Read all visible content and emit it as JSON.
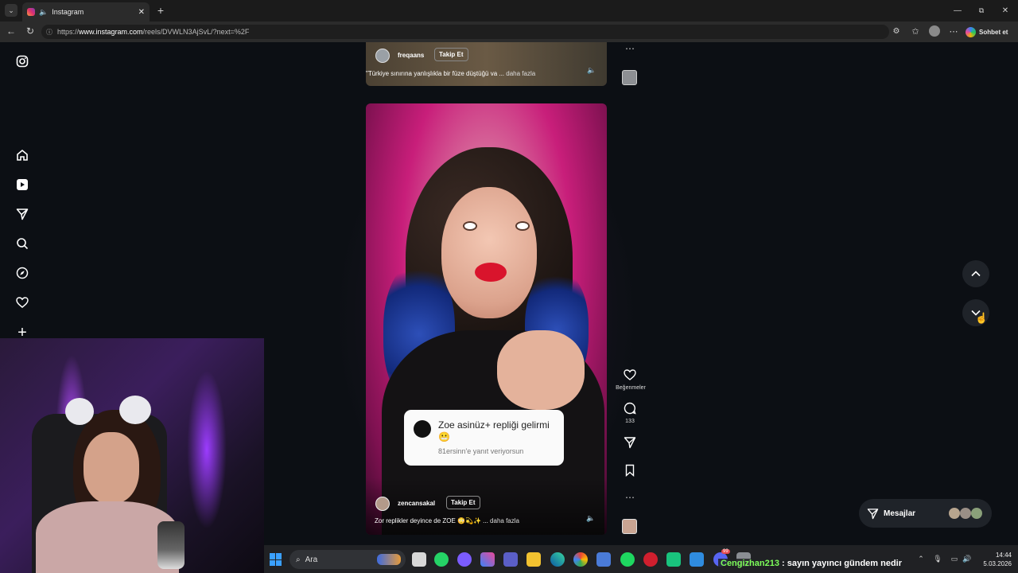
{
  "browser": {
    "tab_title": "Instagram",
    "url_prefix": "https://",
    "url_host": "www.instagram.com",
    "url_path": "/reels/DVWLN3AjSvL/?next=%2F",
    "copilot_label": "Sohbet et"
  },
  "reel_top": {
    "username": "freqaans",
    "follow_label": "Takip Et",
    "caption": "\"Türkiye sınırına yanlışlıkla bir füze düştüğü va ...",
    "more_label": "daha fazla"
  },
  "reel_main": {
    "username": "zencansakal",
    "follow_label": "Takip Et",
    "caption": "Zor replikler deyince de ZOE 😳💫✨ ...",
    "more_label": "daha fazla",
    "likes_label": "Beğenmeler",
    "comment_count": "133"
  },
  "comment_popup": {
    "text": "Zoe asinüz+ repliği gelirmi 😬",
    "reply_hint": "81ersinn'e yanıt veriyorsun"
  },
  "messages": {
    "label": "Mesajlar"
  },
  "taskbar": {
    "search_label": "Ara",
    "chat_user": "Cengizhan213",
    "chat_text": " : sayın yayıncı gündem nedir",
    "time": "14:44",
    "date": "5.03.2026",
    "badge": "99"
  },
  "colors": {
    "page_bg": "#0c0f14",
    "accent_pink": "#c81e7a",
    "chat_user_color": "#7dff5a"
  }
}
